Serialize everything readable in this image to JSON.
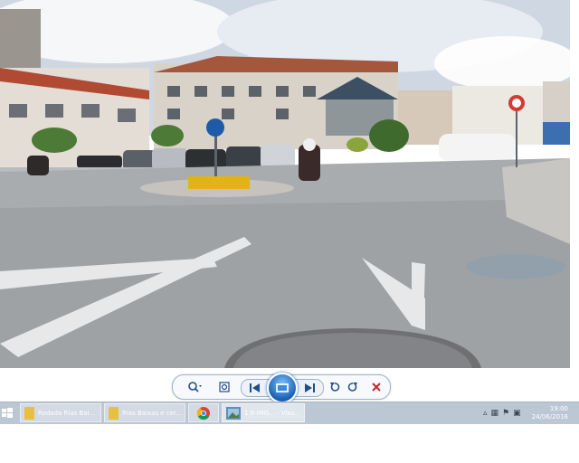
{
  "viewer": {
    "photo_description_alt": ""
  },
  "toolbar": {
    "buttons": [
      "zoom",
      "actual-size",
      "previous",
      "slideshow",
      "next",
      "rotate-left",
      "rotate-right",
      "delete"
    ]
  },
  "taskbar": {
    "tasks": [
      {
        "icon": "folder-icon",
        "label": "Rodada Rías Bai..."
      },
      {
        "icon": "folder-icon",
        "label": "Rías Baixas e cer..."
      },
      {
        "icon": "chrome-icon",
        "label": ""
      },
      {
        "icon": "photo-viewer-icon",
        "label": "1.8-IMG... - Visu..."
      }
    ],
    "clock_time": "19:00",
    "clock_date": "24/06/2016"
  },
  "colors": {
    "accent": "#1a5fb4",
    "delete": "#c0282d",
    "taskbar": "#bcc7d4"
  }
}
